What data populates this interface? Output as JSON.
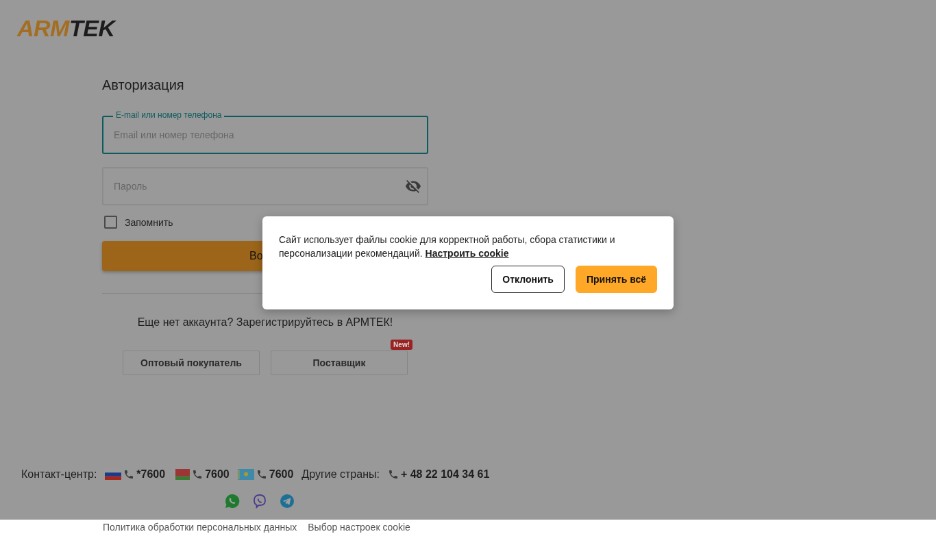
{
  "logo": {
    "accent": "ARM",
    "rest": "TEK"
  },
  "login": {
    "title": "Авторизация",
    "fields": [
      {
        "kind": "text",
        "label": "E-mail или номер телефона",
        "placeholder": "Email или номер телефона",
        "focused": true
      },
      {
        "kind": "password",
        "placeholder": "Пароль",
        "focused": false
      }
    ],
    "remember": {
      "label": "Запомнить",
      "checked": false
    },
    "submit": "Во",
    "register_prompt": "Еще нет аккаунта? Зарегистрируйтесь в АРМТЕК!",
    "register_buttons": [
      {
        "label": "Оптовый покупатель"
      },
      {
        "label": "Поставщик",
        "badge": "New!"
      }
    ]
  },
  "contacts": {
    "label": "Контакт-центр:",
    "phones": [
      {
        "kind": "ru",
        "number": "*7600"
      },
      {
        "kind": "by",
        "number": "7600"
      },
      {
        "kind": "kz",
        "number": "7600"
      }
    ],
    "other_label": "Другие страны:",
    "other_number": "+ 48 22 104 34 61"
  },
  "footer_links": [
    "Политика обработки персональных данных",
    "Выбор настроек cookie"
  ],
  "cookie_banner": {
    "text": "Сайт использует файлы cookie для корректной работы, сбора статистики и персонализации рекомендаций.",
    "link": "Настроить cookie",
    "buttons": [
      {
        "kind": "secondary",
        "label": "Отклонить"
      },
      {
        "kind": "primary",
        "label": "Принять всё"
      }
    ]
  }
}
